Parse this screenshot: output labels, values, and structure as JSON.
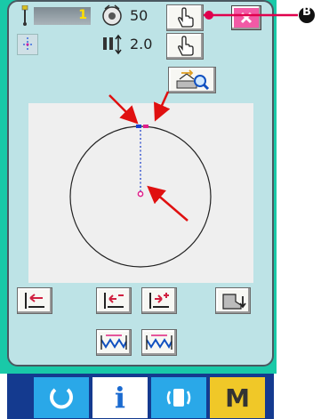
{
  "header": {
    "count_value": "1",
    "tension_value": "50",
    "pitch_value": "2.0"
  },
  "callout": {
    "label": "B"
  },
  "navbar": {
    "info_label": "i",
    "m_label": "M"
  },
  "colors": {
    "panel": "#bde3e6",
    "screen": "#19c9a8",
    "navbar": "#143a8f",
    "callout_line": "#e0004d",
    "close_button": "#f25aa6"
  }
}
